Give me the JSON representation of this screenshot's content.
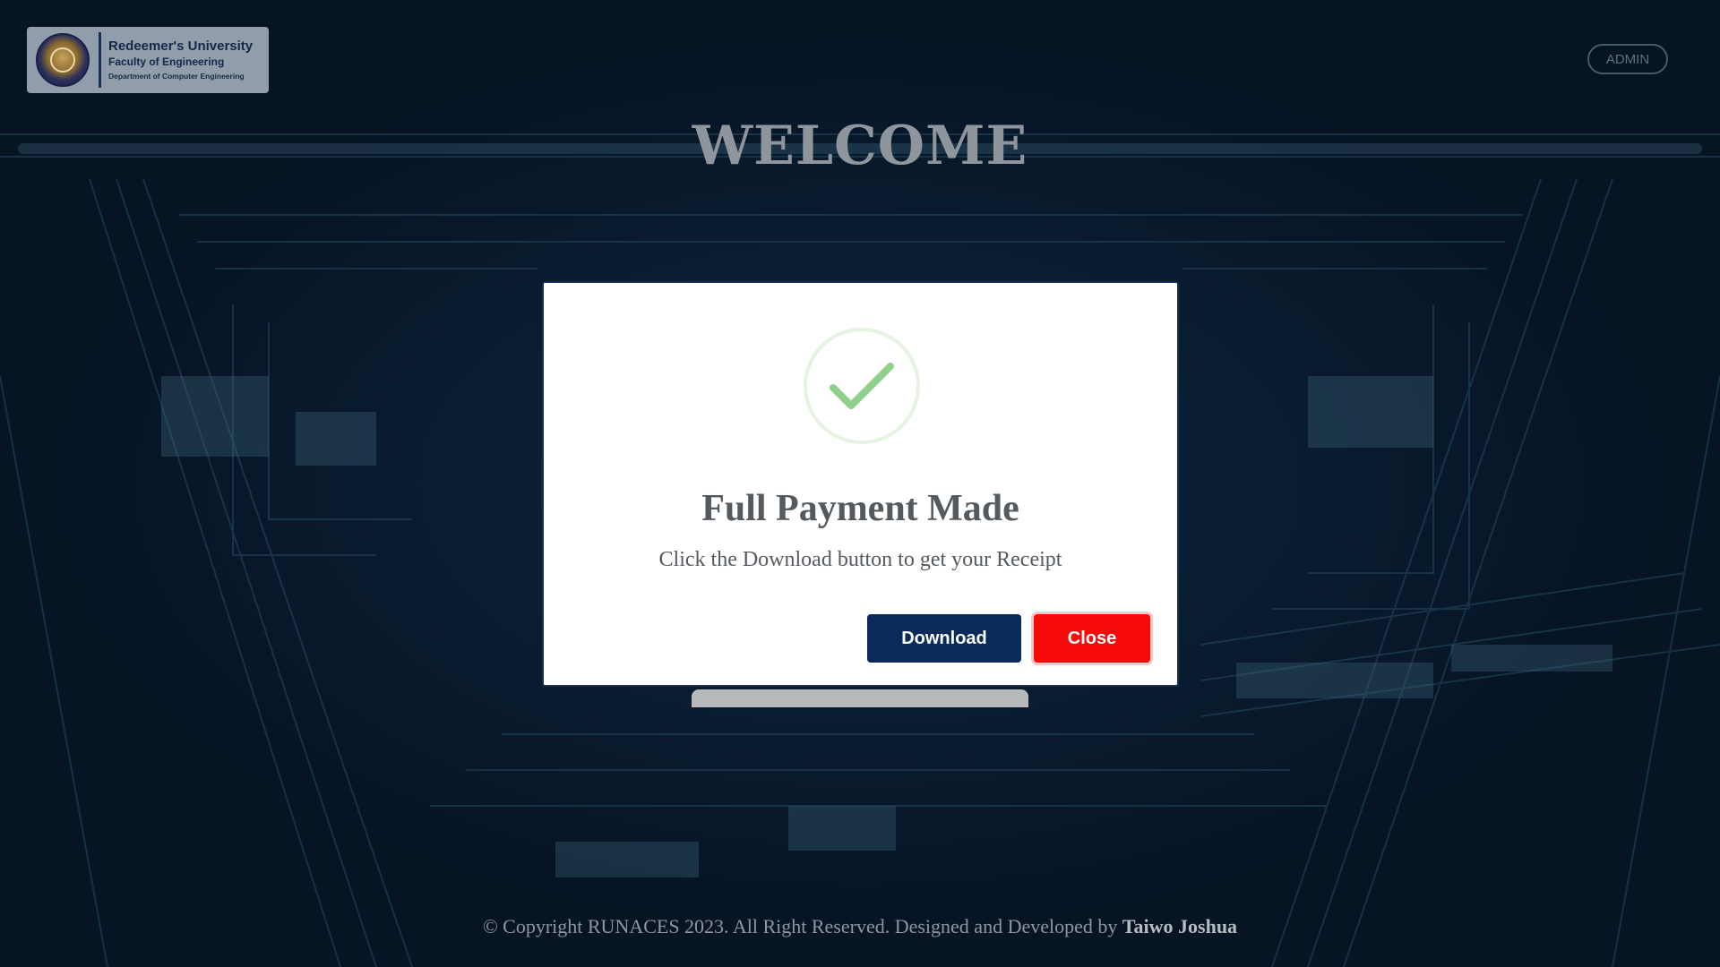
{
  "header": {
    "logo": {
      "university": "Redeemer's University",
      "faculty": "Faculty of Engineering",
      "department": "Department of Computer Engineering"
    },
    "admin_label": "ADMIN",
    "welcome": "WELCOME"
  },
  "modal": {
    "icon": "check-icon",
    "title": "Full Payment Made",
    "message": "Click the Download button to get your Receipt",
    "download_label": "Download",
    "close_label": "Close"
  },
  "footer": {
    "copyright": "© Copyright RUNACES 2023. All Right Reserved. Designed and Developed by",
    "author": "Taiwo Joshua"
  },
  "colors": {
    "download_button": "#0a2a5c",
    "close_button": "#f70a0a",
    "check": "#8fd18a"
  }
}
